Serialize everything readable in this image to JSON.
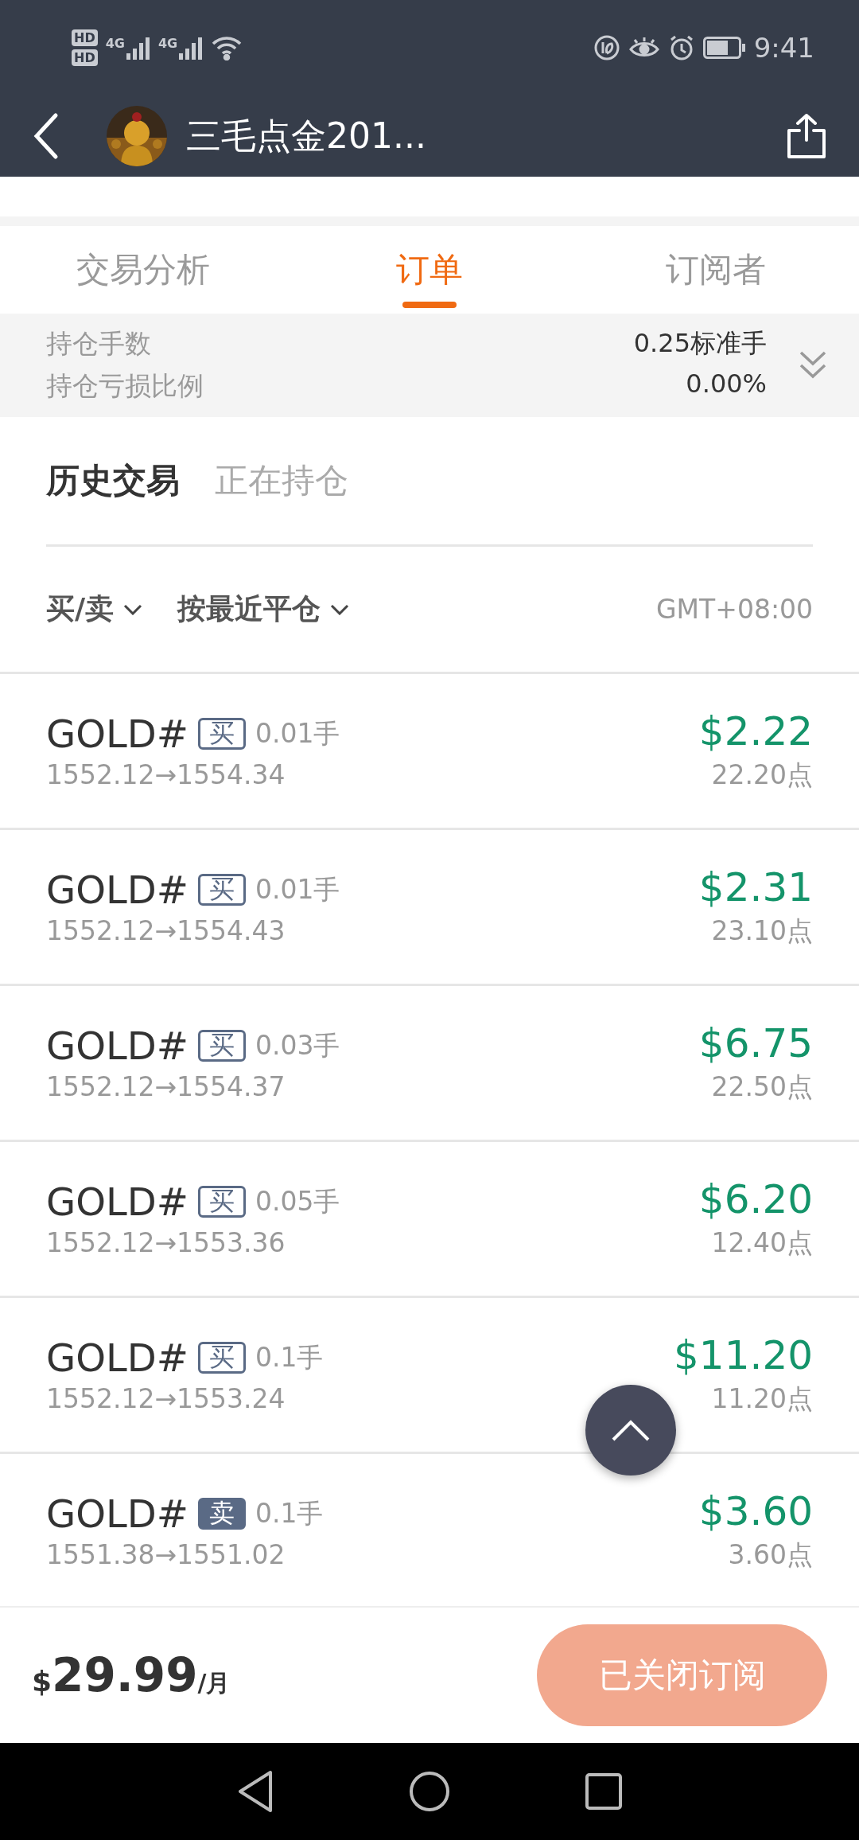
{
  "status_bar": {
    "sim_1": "HD",
    "sim_2": "HD",
    "network_1": "4G",
    "network_2": "4G",
    "time": "9:41"
  },
  "header": {
    "title": "三毛点金201..."
  },
  "tabs": [
    {
      "label": "交易分析",
      "selected": false
    },
    {
      "label": "订单",
      "selected": true
    },
    {
      "label": "订阅者",
      "selected": false
    }
  ],
  "summary": [
    {
      "label": "持仓手数",
      "value": "0.25标准手"
    },
    {
      "label": "持仓亏损比例",
      "value": "0.00%"
    }
  ],
  "sub_tabs": [
    {
      "label": "历史交易",
      "selected": true
    },
    {
      "label": "正在持仓",
      "selected": false
    }
  ],
  "filters": [
    {
      "label": "买/卖"
    },
    {
      "label": "按最近平仓"
    }
  ],
  "timezone": "GMT+08:00",
  "orders": [
    {
      "symbol": "GOLD#",
      "kind": "buy",
      "tag": "买",
      "lots": "0.01手",
      "prices": "1552.12→1554.34",
      "profit": "$2.22",
      "points": "22.20点"
    },
    {
      "symbol": "GOLD#",
      "kind": "buy",
      "tag": "买",
      "lots": "0.01手",
      "prices": "1552.12→1554.43",
      "profit": "$2.31",
      "points": "23.10点"
    },
    {
      "symbol": "GOLD#",
      "kind": "buy",
      "tag": "买",
      "lots": "0.03手",
      "prices": "1552.12→1554.37",
      "profit": "$6.75",
      "points": "22.50点"
    },
    {
      "symbol": "GOLD#",
      "kind": "buy",
      "tag": "买",
      "lots": "0.05手",
      "prices": "1552.12→1553.36",
      "profit": "$6.20",
      "points": "12.40点"
    },
    {
      "symbol": "GOLD#",
      "kind": "buy",
      "tag": "买",
      "lots": "0.1手",
      "prices": "1552.12→1553.24",
      "profit": "$11.20",
      "points": "11.20点"
    },
    {
      "symbol": "GOLD#",
      "kind": "sell",
      "tag": "卖",
      "lots": "0.1手",
      "prices": "1551.38→1551.02",
      "profit": "$3.60",
      "points": "3.60点"
    }
  ],
  "footer": {
    "currency": "$",
    "price": "29.99",
    "period": "/月",
    "button": {
      "label": "已关闭订阅",
      "disabled": true
    }
  }
}
